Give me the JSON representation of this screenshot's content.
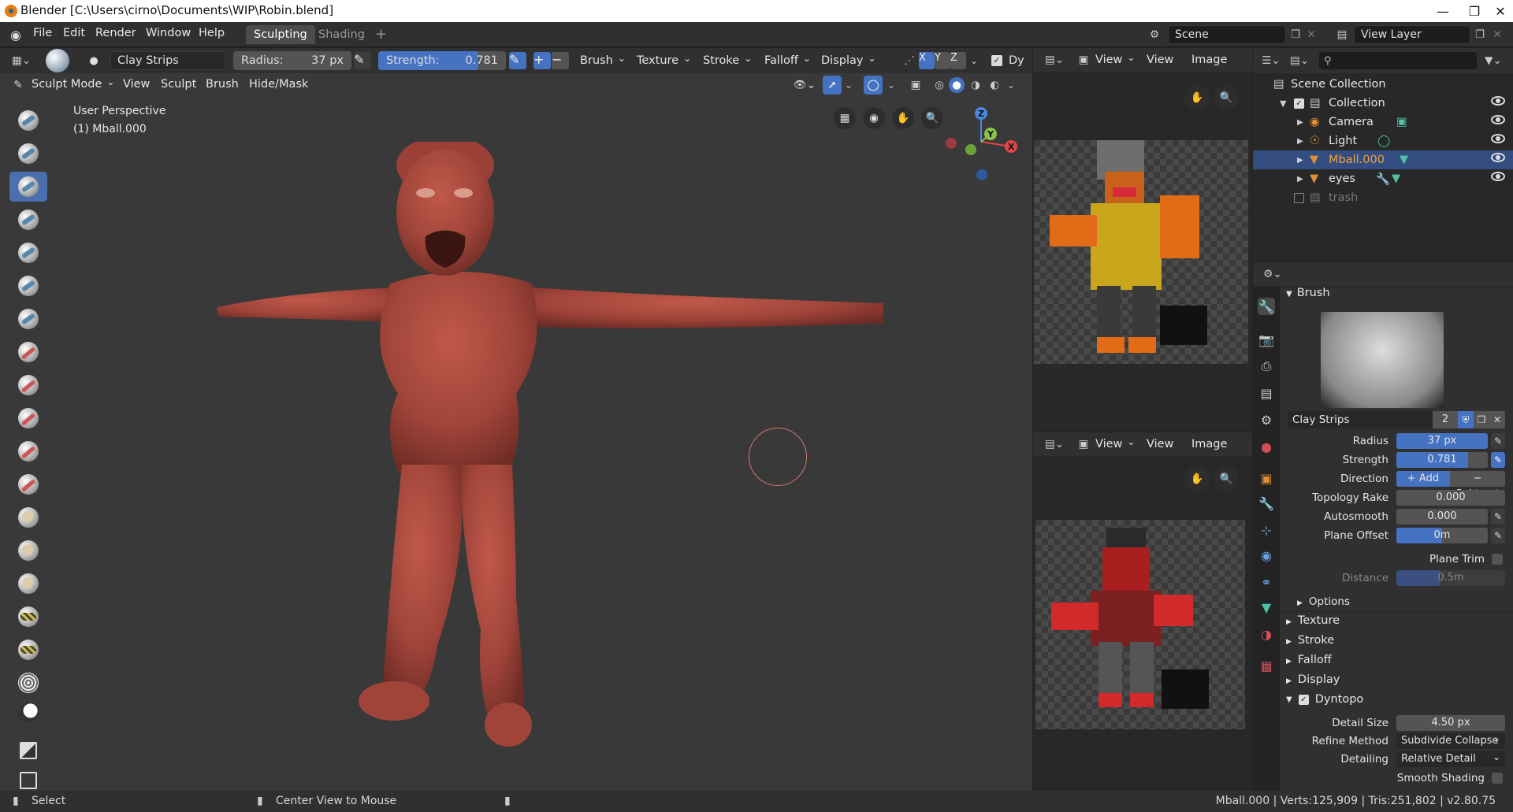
{
  "window": {
    "title": "Blender [C:\\Users\\cirno\\Documents\\WIP\\Robin.blend]",
    "min_icon": "minimize-icon",
    "max_icon": "maximize-icon",
    "close_icon": "close-icon"
  },
  "topbar": {
    "menus": [
      "File",
      "Edit",
      "Render",
      "Window",
      "Help"
    ],
    "workspace_tabs": [
      {
        "label": "Sculpting",
        "active": true
      },
      {
        "label": "Shading",
        "active": false
      }
    ],
    "add_tab": "+",
    "scene_value": "Scene",
    "view_layer_value": "View Layer"
  },
  "tool_header": {
    "brush_name": "Clay Strips",
    "radius_label": "Radius:",
    "radius_value": "37 px",
    "strength_label": "Strength:",
    "strength_value": "0.781",
    "strength_fraction": 0.781,
    "plus": "+",
    "minus": "−",
    "menus": [
      "Brush",
      "Texture",
      "Stroke",
      "Falloff",
      "Display"
    ],
    "axes": [
      "X",
      "Y",
      "Z"
    ],
    "dyntopo_abbrev": "Dy"
  },
  "viewport_header": {
    "mode": "Sculpt Mode",
    "menus": [
      "View",
      "Sculpt",
      "Brush",
      "Hide/Mask"
    ]
  },
  "viewport": {
    "perspective": "User Perspective",
    "object": "(1) Mball.000",
    "gizmo": {
      "z": "Z",
      "y": "Y",
      "x": "X"
    }
  },
  "image_editors": [
    {
      "view_menu": "View",
      "menus": [
        "View",
        "Image"
      ]
    },
    {
      "view_menu": "View",
      "menus": [
        "View",
        "Image"
      ]
    }
  ],
  "outliner": {
    "search_placeholder": "",
    "rows": [
      {
        "label": "Scene Collection",
        "indent": 0,
        "selected": false,
        "dim": false
      },
      {
        "label": "Collection",
        "indent": 1,
        "selected": false,
        "dim": false
      },
      {
        "label": "Camera",
        "indent": 2,
        "selected": false,
        "dim": false
      },
      {
        "label": "Light",
        "indent": 2,
        "selected": false,
        "dim": false
      },
      {
        "label": "Mball.000",
        "indent": 2,
        "selected": true,
        "dim": false
      },
      {
        "label": "eyes",
        "indent": 2,
        "selected": false,
        "dim": false
      },
      {
        "label": "trash",
        "indent": 1,
        "selected": false,
        "dim": true
      }
    ]
  },
  "properties": {
    "panel_title": "Brush",
    "brush_name": "Clay Strips",
    "brush_users": "2",
    "fields": [
      {
        "label": "Radius",
        "value": "37 px",
        "style": "blue"
      },
      {
        "label": "Strength",
        "value": "0.781",
        "style": "blue"
      },
      {
        "label": "Topology Rake",
        "value": "0.000",
        "style": "plain"
      },
      {
        "label": "Autosmooth",
        "value": "0.000",
        "style": "plain"
      },
      {
        "label": "Plane Offset",
        "value": "0m",
        "style": "half"
      }
    ],
    "direction_label": "Direction",
    "direction_add": "+ Add",
    "direction_subtract": "− Subtract",
    "plane_trim_label": "Plane Trim",
    "distance_label": "Distance",
    "distance_value": "0.5m",
    "options_label": "Options",
    "sections": [
      "Texture",
      "Stroke",
      "Falloff",
      "Display"
    ],
    "dyntopo_label": "Dyntopo",
    "detail_size_label": "Detail Size",
    "detail_size_value": "4.50 px",
    "refine_label": "Refine Method",
    "refine_value": "Subdivide Collapse",
    "detailing_label": "Detailing",
    "detailing_value": "Relative Detail",
    "smooth_shading_label": "Smooth Shading"
  },
  "statusbar": {
    "select": "Select",
    "center": "Center View to Mouse",
    "stats": "Mball.000 | Verts:125,909 | Tris:251,802 | v2.80.75"
  },
  "colors": {
    "accent_blue": "#4672c2",
    "selection_row": "#334d80",
    "model_red": "#a8473a",
    "active_tab": "#4c4c4c",
    "panel_bg": "#303030"
  }
}
